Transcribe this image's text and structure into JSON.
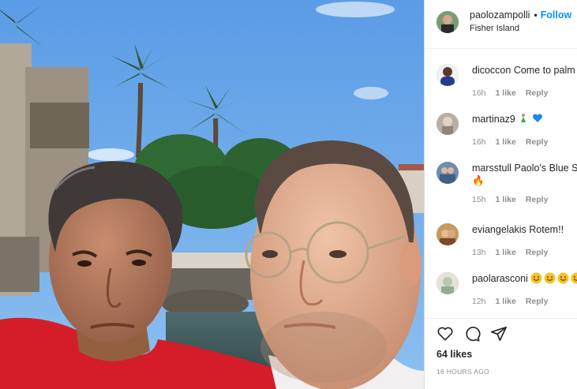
{
  "post": {
    "author": "paolozampolli",
    "separator": "•",
    "follow_label": "Follow",
    "location": "Fisher Island",
    "likes": "64 likes",
    "time_ago": "16 HOURS AGO"
  },
  "comments": [
    {
      "username": "dicoccon",
      "text": "Come to palm",
      "age": "16h",
      "likes": "1 like",
      "reply": "Reply",
      "avatar_color": "#2b3a8c"
    },
    {
      "username": "martinaz9",
      "text": "",
      "emoji_count": 2,
      "age": "16h",
      "likes": "1 like",
      "reply": "Reply",
      "avatar_color": "#b8b0a4"
    },
    {
      "username": "marsstull",
      "text": "Paolo's Blue St",
      "second_line": "🔥",
      "age": "15h",
      "likes": "1 like",
      "reply": "Reply",
      "avatar_color": "#5d7fa5"
    },
    {
      "username": "eviangelakis",
      "text": "Rotem!!",
      "age": "13h",
      "likes": "1 like",
      "reply": "Reply",
      "avatar_color": "#b07f4c"
    },
    {
      "username": "paolarasconi",
      "text": "",
      "emoji_count": 4,
      "age": "12h",
      "likes": "1 like",
      "reply": "Reply",
      "avatar_color": "#c9c4b8"
    }
  ],
  "icons": {
    "like": "heart-icon",
    "comment": "comment-bubble-icon",
    "share": "paper-plane-icon"
  },
  "colors": {
    "link_blue": "#0095f6",
    "text": "#262626",
    "muted": "#8e8e8e",
    "sky": "#63a6e9",
    "shirt_red": "#d51d2a"
  }
}
